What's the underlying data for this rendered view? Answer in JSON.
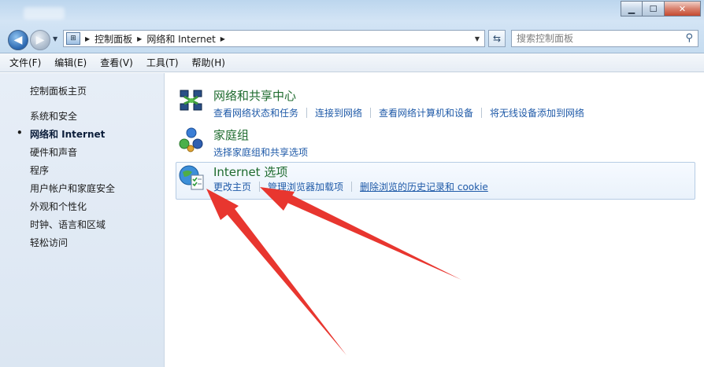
{
  "window": {
    "minimize_glyph": "▁",
    "maximize_glyph": "☐",
    "close_glyph": "✕"
  },
  "nav": {
    "back_glyph": "◀",
    "forward_glyph": "▶",
    "history_glyph": "▼",
    "address_icon_glyph": "⊞",
    "breadcrumbs": [
      "控制面板",
      "网络和 Internet"
    ],
    "crumb_sep": "▶",
    "dropdown_glyph": "▼",
    "refresh_glyph": "⇆",
    "search_placeholder": "搜索控制面板",
    "search_glyph": "⚲"
  },
  "menubar": {
    "items": [
      "文件(F)",
      "编辑(E)",
      "查看(V)",
      "工具(T)",
      "帮助(H)"
    ]
  },
  "sidebar": {
    "home": "控制面板主页",
    "bullet": "•",
    "items": [
      {
        "label": "系统和安全",
        "active": false
      },
      {
        "label": "网络和 Internet",
        "active": true
      },
      {
        "label": "硬件和声音",
        "active": false
      },
      {
        "label": "程序",
        "active": false
      },
      {
        "label": "用户帐户和家庭安全",
        "active": false
      },
      {
        "label": "外观和个性化",
        "active": false
      },
      {
        "label": "时钟、语言和区域",
        "active": false
      },
      {
        "label": "轻松访问",
        "active": false
      }
    ]
  },
  "main": {
    "categories": [
      {
        "title": "网络和共享中心",
        "icon": "network-sharing-icon",
        "links": [
          "查看网络状态和任务",
          "连接到网络",
          "查看网络计算机和设备",
          "将无线设备添加到网络"
        ]
      },
      {
        "title": "家庭组",
        "icon": "homegroup-icon",
        "links": [
          "选择家庭组和共享选项"
        ]
      },
      {
        "title": "Internet 选项",
        "icon": "internet-options-icon",
        "links": [
          "更改主页",
          "管理浏览器加载项",
          "删除浏览的历史记录和 cookie"
        ]
      }
    ]
  },
  "colors": {
    "category_title": "#1e6b2e",
    "link": "#1f5aa8",
    "annotation_arrow": "#e8362f"
  }
}
